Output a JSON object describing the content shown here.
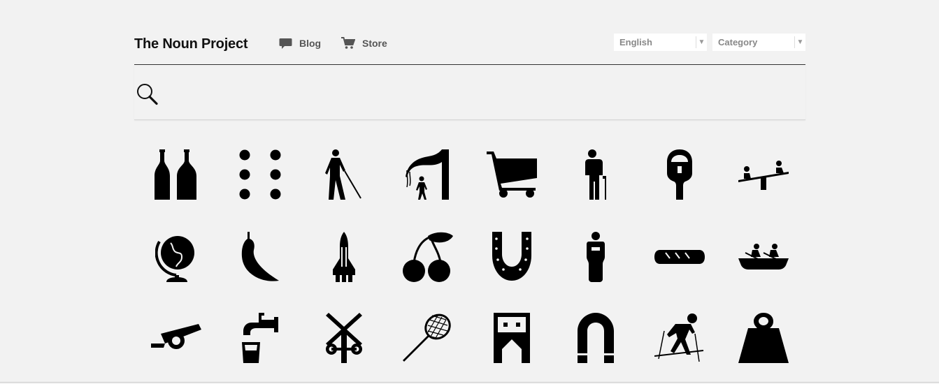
{
  "header": {
    "logo": "The Noun Project",
    "nav": [
      {
        "label": "Blog",
        "icon": "speech-bubble-icon"
      },
      {
        "label": "Store",
        "icon": "cart-icon"
      }
    ],
    "language_select": {
      "value": "English"
    },
    "category_select": {
      "value": "Category"
    }
  },
  "search": {
    "value": "",
    "placeholder": "",
    "icon": "magnifier-icon"
  },
  "icons": [
    "bottles-icon",
    "braille-dots-icon",
    "blind-walker-icon",
    "waterfall-icon",
    "shopping-cart-icon",
    "elderly-person-icon",
    "parking-meter-icon",
    "seesaw-icon",
    "globe-icon",
    "chili-pepper-icon",
    "space-shuttle-icon",
    "cherries-icon",
    "horseshoe-icon",
    "hands-bound-person-icon",
    "bread-loaf-icon",
    "canoe-icon",
    "cannon-icon",
    "faucet-cup-icon",
    "railroad-crossing-icon",
    "badminton-racket-icon",
    "cabinet-icon",
    "magnet-icon",
    "skier-icon",
    "weight-icon"
  ],
  "colors": {
    "background": "#f2f2f2",
    "icon": "#000000",
    "nav_text": "#555555"
  }
}
